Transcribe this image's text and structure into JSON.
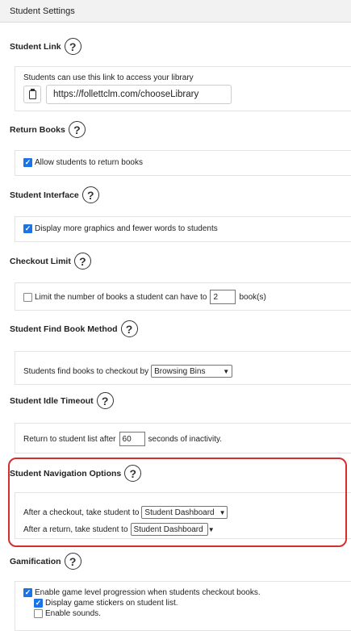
{
  "header": {
    "title": "Student Settings"
  },
  "help_glyph": "?",
  "student_link": {
    "title": "Student Link",
    "description": "Students can use this link to access your library",
    "url": "https://follettclm.com/chooseLibrary",
    "copy_icon": "clipboard-icon"
  },
  "return_books": {
    "title": "Return Books",
    "allow_label": "Allow students to return books",
    "allow_checked": true
  },
  "student_interface": {
    "title": "Student Interface",
    "graphics_label": "Display more graphics and fewer words to students",
    "graphics_checked": true
  },
  "checkout_limit": {
    "title": "Checkout Limit",
    "limit_label": "Limit the number of books a student can have to",
    "limit_checked": false,
    "limit_value": "2",
    "unit_label": "book(s)"
  },
  "find_book_method": {
    "title": "Student Find Book Method",
    "label": "Students find books to checkout by",
    "selected": "Browsing Bins"
  },
  "idle_timeout": {
    "title": "Student Idle Timeout",
    "prefix": "Return to student list after",
    "value": "60",
    "suffix": "seconds of inactivity."
  },
  "navigation_options": {
    "title": "Student Navigation Options",
    "after_checkout_label": "After a checkout, take student to",
    "after_checkout_selected": "Student Dashboard",
    "after_return_label": "After a return, take student to",
    "after_return_selected": "Student Dashboard",
    "highlight_color": "#d32f2f"
  },
  "gamification": {
    "title": "Gamification",
    "game_level_label": "Enable game level progression when students checkout books.",
    "game_level_checked": true,
    "stickers_label": "Display game stickers on student list.",
    "stickers_checked": true,
    "sounds_label": "Enable sounds.",
    "sounds_checked": false
  },
  "colors": {
    "checkbox_accent": "#1a73e8",
    "header_bg": "#f2f2f2"
  }
}
